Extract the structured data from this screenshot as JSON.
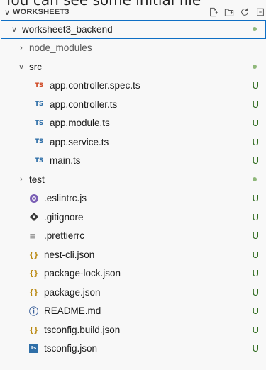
{
  "caption": "You can see some initial file",
  "explorer": {
    "workspace_title": "WORKSHEET3",
    "actions": [
      {
        "name": "new-file-icon"
      },
      {
        "name": "new-folder-icon"
      },
      {
        "name": "refresh-icon"
      },
      {
        "name": "collapse-all-icon"
      }
    ],
    "rows": [
      {
        "label": "worksheet3_backend",
        "kind": "folder-open",
        "depth": 1,
        "status": "dot"
      },
      {
        "label": "node_modules",
        "kind": "folder-closed",
        "depth": 2,
        "status": ""
      },
      {
        "label": "src",
        "kind": "folder-open",
        "depth": 2,
        "status": "dot"
      },
      {
        "label": "app.controller.spec.ts",
        "kind": "ts-spec",
        "depth": 3,
        "status": "U"
      },
      {
        "label": "app.controller.ts",
        "kind": "ts",
        "depth": 3,
        "status": "U"
      },
      {
        "label": "app.module.ts",
        "kind": "ts",
        "depth": 3,
        "status": "U"
      },
      {
        "label": "app.service.ts",
        "kind": "ts",
        "depth": 3,
        "status": "U"
      },
      {
        "label": "main.ts",
        "kind": "ts",
        "depth": 3,
        "status": "U"
      },
      {
        "label": "test",
        "kind": "folder-closed",
        "depth": 2,
        "status": "dot"
      },
      {
        "label": ".eslintrc.js",
        "kind": "eslint",
        "depth": 2,
        "status": "U"
      },
      {
        "label": ".gitignore",
        "kind": "git",
        "depth": 2,
        "status": "U"
      },
      {
        "label": ".prettierrc",
        "kind": "prettier",
        "depth": 2,
        "status": "U"
      },
      {
        "label": "nest-cli.json",
        "kind": "json",
        "depth": 2,
        "status": "U"
      },
      {
        "label": "package-lock.json",
        "kind": "json",
        "depth": 2,
        "status": "U"
      },
      {
        "label": "package.json",
        "kind": "json",
        "depth": 2,
        "status": "U"
      },
      {
        "label": "README.md",
        "kind": "info",
        "depth": 2,
        "status": "U"
      },
      {
        "label": "tsconfig.build.json",
        "kind": "json",
        "depth": 2,
        "status": "U"
      },
      {
        "label": "tsconfig.json",
        "kind": "tsconfig",
        "depth": 2,
        "status": "U"
      }
    ],
    "icon_glyphs": {
      "ts": "TS",
      "chevron_down": "∨",
      "chevron_right": "›",
      "json": "{}",
      "git": "◆",
      "prettier": "≡",
      "info": "ⓘ",
      "tsconfig": "ts"
    },
    "colors": {
      "accent_border": "#0f6fc5",
      "untracked": "#2f6b1e",
      "dot": "#8fb87a",
      "ts_spec": "#d04a26",
      "ts": "#2f6fa8"
    }
  }
}
